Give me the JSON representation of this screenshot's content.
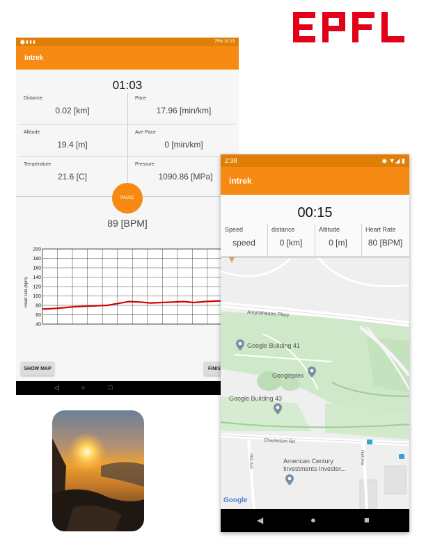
{
  "logo": {
    "text": "EPFL",
    "color": "#e2001a"
  },
  "colors": {
    "accent": "#f68a12",
    "status_bar": "#e07f08",
    "heart_line": "#d40000"
  },
  "phone1": {
    "status": {
      "right": "75% 10:13"
    },
    "app_title": "intrek",
    "timer": "01:03",
    "metrics": [
      {
        "label": "Distance",
        "value": "0.02 [km]"
      },
      {
        "label": "Pace",
        "value": "17.96 [min/km]"
      },
      {
        "label": "Altitude",
        "value": "19.4 [m]"
      },
      {
        "label": "Ave Pace",
        "value": "0 [min/km]"
      },
      {
        "label": "Temperature",
        "value": "21.6 [C]"
      },
      {
        "label": "Pressure",
        "value": "1090.86 [MPa]"
      }
    ],
    "pause_label": "PAUSE",
    "bpm": "89 [BPM]",
    "show_map_label": "SHOW MAP",
    "finish_label": "FINIS",
    "nav_icons": [
      "back-icon",
      "home-icon",
      "recents-icon"
    ]
  },
  "chart_data": {
    "type": "line",
    "ylabel": "Heart rate (bpm)",
    "ylim": [
      40,
      200
    ],
    "yticks": [
      "200",
      "180",
      "160",
      "140",
      "120",
      "100",
      "80",
      "60",
      "40"
    ],
    "grid": true,
    "series": [
      {
        "values": [
          72,
          73,
          75,
          77,
          78,
          79,
          80,
          84,
          88,
          87,
          85,
          86,
          87,
          88,
          86,
          88,
          89,
          90,
          91
        ]
      }
    ]
  },
  "phone2": {
    "status": {
      "time": "2:38"
    },
    "app_title": "intrek",
    "timer": "00:15",
    "columns": [
      {
        "label": "Speed",
        "value": "speed"
      },
      {
        "label": "distance",
        "value": "0 [km]"
      },
      {
        "label": "Altitude",
        "value": "0 [m]"
      },
      {
        "label": "Heart Rate",
        "value": "80 [BPM]"
      }
    ],
    "map": {
      "roads": [
        "Amphitheatre Pkwy",
        "Charleston Rd",
        "Alta Ave",
        "Huff Ave"
      ],
      "places": [
        "Google Building 41",
        "Googleplex",
        "Google Building 43",
        "American Century",
        "Investments Investor..."
      ],
      "attribution": "Google"
    },
    "nav_icons": [
      "back-icon",
      "home-icon",
      "recents-icon"
    ]
  }
}
